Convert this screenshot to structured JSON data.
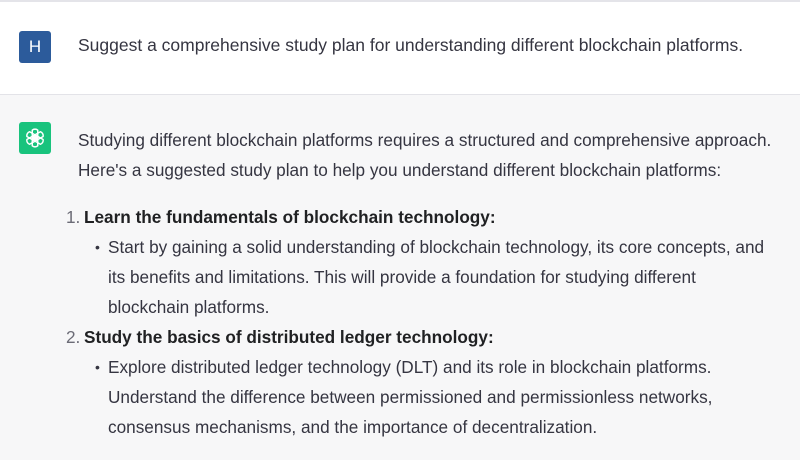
{
  "user_message": {
    "avatar_letter": "H",
    "text": "Suggest a comprehensive study plan for understanding different blockchain platforms."
  },
  "assistant_message": {
    "avatar_icon": "openai-logo-icon",
    "intro_lines": [
      "Studying different blockchain platforms requires a structured and comprehensive approach.",
      "Here's a suggested study plan to help you understand different blockchain platforms:"
    ],
    "items": [
      {
        "number": "1.",
        "title": "Learn the fundamentals of blockchain technology:",
        "bullet_lines": [
          "Start by gaining a solid understanding of blockchain technology, its core concepts, and",
          "its benefits and limitations. This will provide a foundation for studying different",
          "blockchain platforms."
        ]
      },
      {
        "number": "2.",
        "title": "Study the basics of distributed ledger technology:",
        "bullet_lines": [
          "Explore distributed ledger technology (DLT) and its role in blockchain platforms.",
          "Understand the difference between permissioned and permissionless networks,",
          "consensus mechanisms, and the importance of decentralization."
        ]
      }
    ]
  },
  "colors": {
    "user_avatar_bg": "#2c5b9b",
    "assistant_avatar_bg": "#19c37d",
    "assistant_row_bg": "#f7f7f8"
  }
}
